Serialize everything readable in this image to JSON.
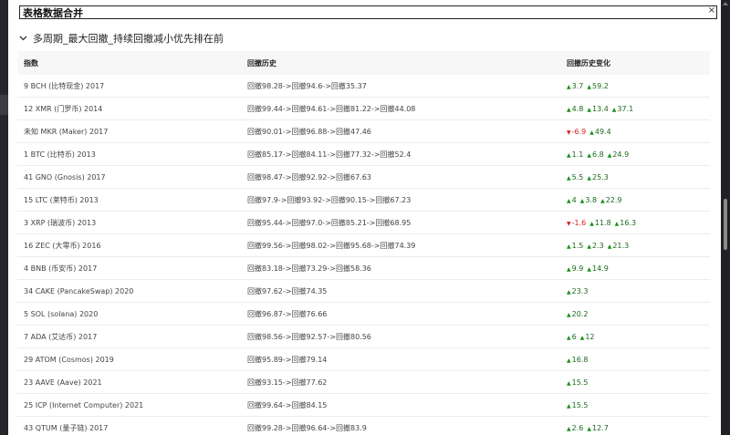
{
  "panel": {
    "title": "表格数据合并",
    "close": "×"
  },
  "section": {
    "title": "多周期_最大回撤_持续回撤减小优先排在前"
  },
  "table": {
    "headers": [
      "指数",
      "回撤历史",
      "回撤历史变化"
    ],
    "rows": [
      {
        "index": "9 BCH (比特现金) 2017",
        "history": "回撤98.28->回撤94.6->回撤35.37",
        "changes": [
          {
            "dir": "up",
            "v": "3.7"
          },
          {
            "dir": "up",
            "v": "59.2"
          }
        ]
      },
      {
        "index": "12 XMR (门罗币) 2014",
        "history": "回撤99.44->回撤94.61->回撤81.22->回撤44.08",
        "changes": [
          {
            "dir": "up",
            "v": "4.8"
          },
          {
            "dir": "up",
            "v": "13.4"
          },
          {
            "dir": "up",
            "v": "37.1"
          }
        ]
      },
      {
        "index": "未知 MKR (Maker) 2017",
        "history": "回撤90.01->回撤96.88->回撤47.46",
        "changes": [
          {
            "dir": "down",
            "v": "-6.9"
          },
          {
            "dir": "up",
            "v": "49.4"
          }
        ]
      },
      {
        "index": "1 BTC (比特币) 2013",
        "history": "回撤85.17->回撤84.11->回撤77.32->回撤52.4",
        "changes": [
          {
            "dir": "up",
            "v": "1.1"
          },
          {
            "dir": "up",
            "v": "6.8"
          },
          {
            "dir": "up",
            "v": "24.9"
          }
        ]
      },
      {
        "index": "41 GNO (Gnosis) 2017",
        "history": "回撤98.47->回撤92.92->回撤67.63",
        "changes": [
          {
            "dir": "up",
            "v": "5.5"
          },
          {
            "dir": "up",
            "v": "25.3"
          }
        ]
      },
      {
        "index": "15 LTC (莱特币) 2013",
        "history": "回撤97.9->回撤93.92->回撤90.15->回撤67.23",
        "changes": [
          {
            "dir": "up",
            "v": "4"
          },
          {
            "dir": "up",
            "v": "3.8"
          },
          {
            "dir": "up",
            "v": "22.9"
          }
        ]
      },
      {
        "index": "3 XRP (瑞波币) 2013",
        "history": "回撤95.44->回撤97.0->回撤85.21->回撤68.95",
        "changes": [
          {
            "dir": "down",
            "v": "-1.6"
          },
          {
            "dir": "up",
            "v": "11.8"
          },
          {
            "dir": "up",
            "v": "16.3"
          }
        ]
      },
      {
        "index": "16 ZEC (大零币) 2016",
        "history": "回撤99.56->回撤98.02->回撤95.68->回撤74.39",
        "changes": [
          {
            "dir": "up",
            "v": "1.5"
          },
          {
            "dir": "up",
            "v": "2.3"
          },
          {
            "dir": "up",
            "v": "21.3"
          }
        ]
      },
      {
        "index": "4 BNB (币安币) 2017",
        "history": "回撤83.18->回撤73.29->回撤58.36",
        "changes": [
          {
            "dir": "up",
            "v": "9.9"
          },
          {
            "dir": "up",
            "v": "14.9"
          }
        ]
      },
      {
        "index": "34 CAKE (PancakeSwap) 2020",
        "history": "回撤97.62->回撤74.35",
        "changes": [
          {
            "dir": "up",
            "v": "23.3"
          }
        ]
      },
      {
        "index": "5 SOL (solana) 2020",
        "history": "回撤96.87->回撤76.66",
        "changes": [
          {
            "dir": "up",
            "v": "20.2"
          }
        ]
      },
      {
        "index": "7 ADA (艾达币) 2017",
        "history": "回撤98.56->回撤92.57->回撤80.56",
        "changes": [
          {
            "dir": "up",
            "v": "6"
          },
          {
            "dir": "up",
            "v": "12"
          }
        ]
      },
      {
        "index": "29 ATOM (Cosmos) 2019",
        "history": "回撤95.89->回撤79.14",
        "changes": [
          {
            "dir": "up",
            "v": "16.8"
          }
        ]
      },
      {
        "index": "23 AAVE (Aave) 2021",
        "history": "回撤93.15->回撤77.62",
        "changes": [
          {
            "dir": "up",
            "v": "15.5"
          }
        ]
      },
      {
        "index": "25 ICP (Internet Computer) 2021",
        "history": "回撤99.64->回撤84.15",
        "changes": [
          {
            "dir": "up",
            "v": "15.5"
          }
        ]
      },
      {
        "index": "43 QTUM (量子链) 2017",
        "history": "回撤99.28->回撤96.64->回撤83.9",
        "changes": [
          {
            "dir": "up",
            "v": "2.6"
          },
          {
            "dir": "up",
            "v": "12.7"
          }
        ]
      }
    ]
  },
  "colors": {
    "up": "#1a8f1a",
    "down": "#d92020"
  }
}
